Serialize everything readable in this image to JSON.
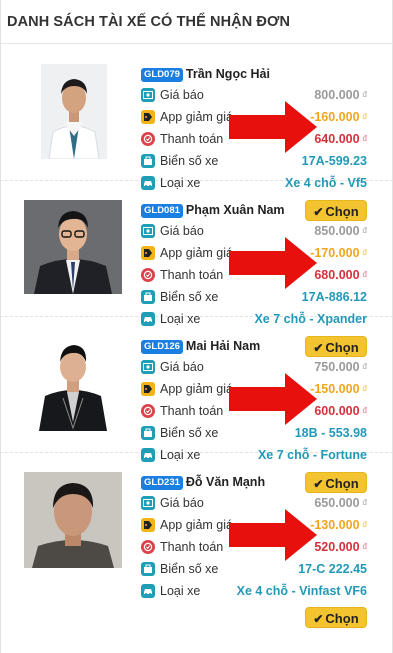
{
  "page": {
    "title": "DANH SÁCH TÀI XẾ CÓ THỂ NHẬN ĐƠN"
  },
  "labels": {
    "price": "Giá báo",
    "discount": "App giảm giá",
    "payment": "Thanh toán",
    "plate": "Biển số xe",
    "vehicle": "Loại xe",
    "currency": "đ",
    "select_button": "Chọn"
  },
  "colors": {
    "code_badge": "#1a7fe0",
    "select_button": "#f4c430",
    "discount": "#f2a51c",
    "payment": "#d6303c",
    "plate": "#2299b8",
    "arrow": "#e8100c"
  },
  "drivers": [
    {
      "code": "GLD079",
      "name": "Trần Ngọc Hải",
      "price": "800.000",
      "discount": "-160.000",
      "payment": "640.000",
      "plate": "17A-599.23",
      "vehicle": "Xe 4 chỗ - Vf5"
    },
    {
      "code": "GLD081",
      "name": "Phạm Xuân Nam",
      "price": "850.000",
      "discount": "-170.000",
      "payment": "680.000",
      "plate": "17A-886.12",
      "vehicle": "Xe 7 chỗ - Xpander"
    },
    {
      "code": "GLD126",
      "name": "Mai Hải Nam",
      "price": "750.000",
      "discount": "-150.000",
      "payment": "600.000",
      "plate": "18B - 553.98",
      "vehicle": "Xe 7 chỗ - Fortune"
    },
    {
      "code": "GLD231",
      "name": "Đỗ Văn Mạnh",
      "price": "650.000",
      "discount": "-130.000",
      "payment": "520.000",
      "plate": "17-C 222.45",
      "vehicle": "Xe 4 chỗ - Vinfast VF6"
    }
  ]
}
